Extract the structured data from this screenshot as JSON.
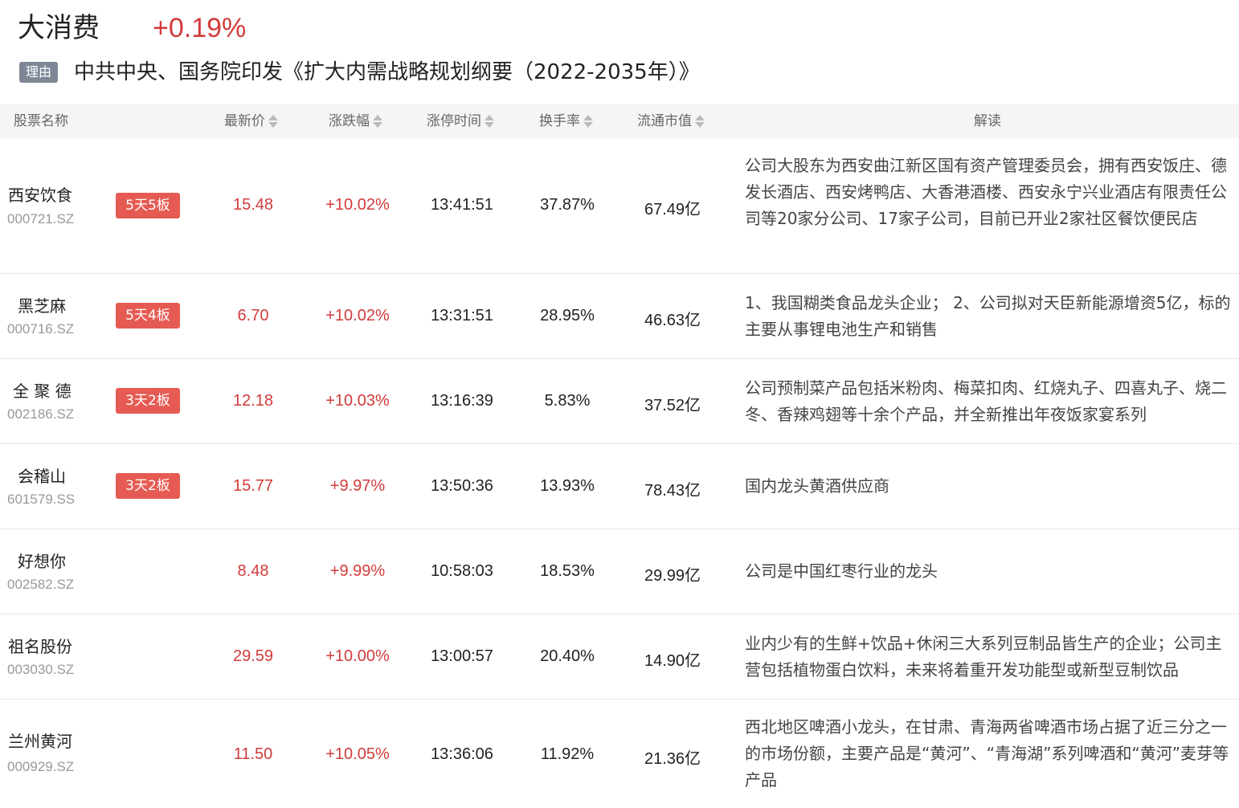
{
  "sector": {
    "name": "大消费",
    "change": "+0.19%"
  },
  "reason": {
    "tag": "理由",
    "text": "中共中央、国务院印发《扩大内需战略规划纲要（2022-2035年）》"
  },
  "columns": {
    "name": "股票名称",
    "price": "最新价",
    "change": "涨跌幅",
    "limit_time": "涨停时间",
    "turnover": "换手率",
    "float_cap": "流通市值",
    "note": "解读"
  },
  "rows": [
    {
      "name": "西安饮食",
      "code": "000721.SZ",
      "badge": "5天5板",
      "price": "15.48",
      "change": "+10.02%",
      "time": "13:41:51",
      "turnover": "37.87%",
      "cap": "67.49亿",
      "note": "公司大股东为西安曲江新区国有资产管理委员会，拥有西安饭庄、德发长酒店、西安烤鸭店、大香港酒楼、西安永宁兴业酒店有限责任公司等20家分公司、17家子公司，目前已开业2家社区餐饮便民店"
    },
    {
      "name": "黑芝麻",
      "code": "000716.SZ",
      "badge": "5天4板",
      "price": "6.70",
      "change": "+10.02%",
      "time": "13:31:51",
      "turnover": "28.95%",
      "cap": "46.63亿",
      "note": "1、我国糊类食品龙头企业； 2、公司拟对天臣新能源增资5亿，标的主要从事锂电池生产和销售"
    },
    {
      "name": "全 聚 德",
      "code": "002186.SZ",
      "badge": "3天2板",
      "price": "12.18",
      "change": "+10.03%",
      "time": "13:16:39",
      "turnover": "5.83%",
      "cap": "37.52亿",
      "note": "公司预制菜产品包括米粉肉、梅菜扣肉、红烧丸子、四喜丸子、烧二冬、香辣鸡翅等十余个产品，并全新推出年夜饭家宴系列"
    },
    {
      "name": "会稽山",
      "code": "601579.SS",
      "badge": "3天2板",
      "price": "15.77",
      "change": "+9.97%",
      "time": "13:50:36",
      "turnover": "13.93%",
      "cap": "78.43亿",
      "note": "国内龙头黄酒供应商"
    },
    {
      "name": "好想你",
      "code": "002582.SZ",
      "badge": "",
      "price": "8.48",
      "change": "+9.99%",
      "time": "10:58:03",
      "turnover": "18.53%",
      "cap": "29.99亿",
      "note": "公司是中国红枣行业的龙头"
    },
    {
      "name": "祖名股份",
      "code": "003030.SZ",
      "badge": "",
      "price": "29.59",
      "change": "+10.00%",
      "time": "13:00:57",
      "turnover": "20.40%",
      "cap": "14.90亿",
      "note": "业内少有的生鲜+饮品+休闲三大系列豆制品皆生产的企业；公司主营包括植物蛋白饮料，未来将着重开发功能型或新型豆制饮品"
    },
    {
      "name": "兰州黄河",
      "code": "000929.SZ",
      "badge": "",
      "price": "11.50",
      "change": "+10.05%",
      "time": "13:36:06",
      "turnover": "11.92%",
      "cap": "21.36亿",
      "note": "西北地区啤酒小龙头，在甘肃、青海两省啤酒市场占据了近三分之一的市场份额，主要产品是“黄河”、“青海湖”系列啤酒和“黄河”麦芽等产品"
    }
  ]
}
